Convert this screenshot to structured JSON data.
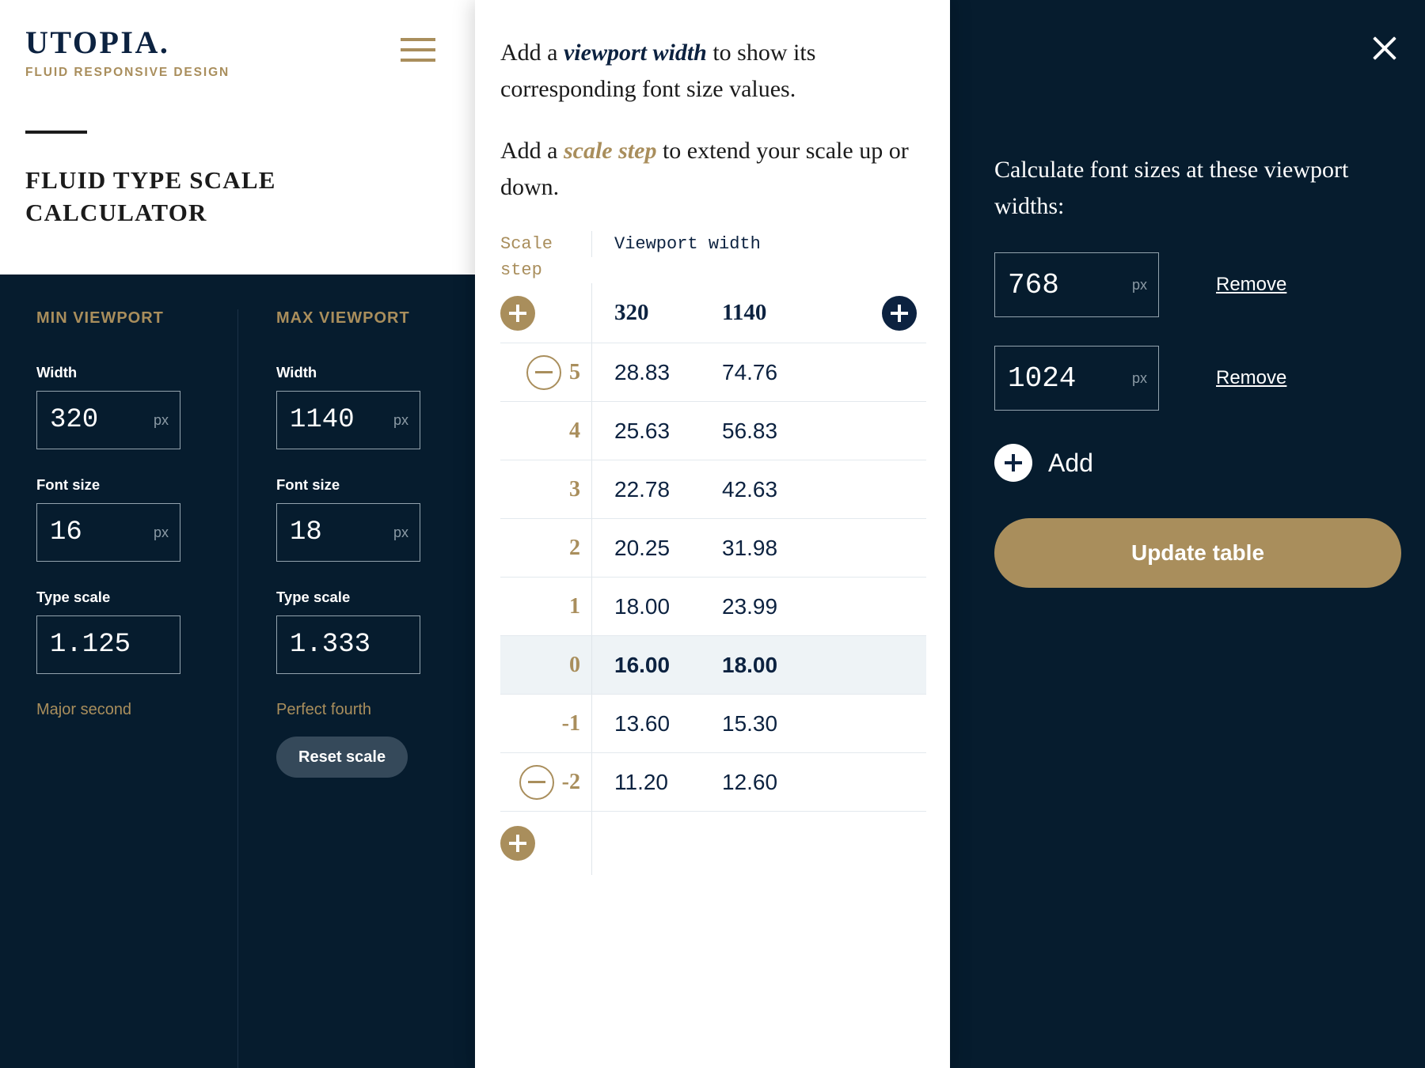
{
  "brand": {
    "name": "UTOPIA.",
    "tagline": "FLUID RESPONSIVE DESIGN",
    "menu_icon": "hamburger-icon"
  },
  "page": {
    "title": "FLUID TYPE SCALE CALCULATOR"
  },
  "form": {
    "min": {
      "heading": "MIN VIEWPORT",
      "width_label": "Width",
      "width_value": "320",
      "width_unit": "px",
      "font_size_label": "Font size",
      "font_size_value": "16",
      "font_size_unit": "px",
      "type_scale_label": "Type scale",
      "type_scale_value": "1.125",
      "scale_name": "Major second"
    },
    "max": {
      "heading": "MAX VIEWPORT",
      "width_label": "Width",
      "width_value": "1140",
      "width_unit": "px",
      "font_size_label": "Font size",
      "font_size_value": "18",
      "font_size_unit": "px",
      "type_scale_label": "Type scale",
      "type_scale_value": "1.333",
      "scale_name": "Perfect fourth",
      "reset_label": "Reset scale"
    }
  },
  "middle": {
    "para1_a": "Add a ",
    "para1_em": "viewport width",
    "para1_b": " to show its corresponding font size values.",
    "para2_a": "Add a ",
    "para2_em": "scale step",
    "para2_b": " to extend your scale up or down."
  },
  "table": {
    "col_step_label": "Scale step",
    "col_viewport_label": "Viewport width",
    "headers": [
      "320",
      "1140"
    ],
    "add_step_top_icon": "plus-icon",
    "add_step_bottom_icon": "plus-icon",
    "add_viewport_icon": "plus-icon",
    "remove_step_icon": "minus-icon",
    "rows": [
      {
        "step": "5",
        "v1": "28.83",
        "v2": "74.76",
        "remove": true,
        "highlight": false
      },
      {
        "step": "4",
        "v1": "25.63",
        "v2": "56.83",
        "remove": false,
        "highlight": false
      },
      {
        "step": "3",
        "v1": "22.78",
        "v2": "42.63",
        "remove": false,
        "highlight": false
      },
      {
        "step": "2",
        "v1": "20.25",
        "v2": "31.98",
        "remove": false,
        "highlight": false
      },
      {
        "step": "1",
        "v1": "18.00",
        "v2": "23.99",
        "remove": false,
        "highlight": false
      },
      {
        "step": "0",
        "v1": "16.00",
        "v2": "18.00",
        "remove": false,
        "highlight": true
      },
      {
        "step": "-1",
        "v1": "13.60",
        "v2": "15.30",
        "remove": false,
        "highlight": false
      },
      {
        "step": "-2",
        "v1": "11.20",
        "v2": "12.60",
        "remove": true,
        "highlight": false
      }
    ]
  },
  "right": {
    "close_icon": "close-icon",
    "lead": "Calculate font sizes at these viewport widths:",
    "viewports": [
      {
        "value": "768",
        "unit": "px",
        "remove_label": "Remove"
      },
      {
        "value": "1024",
        "unit": "px",
        "remove_label": "Remove"
      }
    ],
    "add_label": "Add",
    "add_icon": "plus-icon",
    "update_label": "Update table"
  },
  "colors": {
    "navy": "#061c2e",
    "navy_text": "#0c2240",
    "gold": "#a98e5c",
    "white": "#ffffff",
    "row_highlight": "#eef3f6",
    "reset_btn": "#35495a"
  }
}
